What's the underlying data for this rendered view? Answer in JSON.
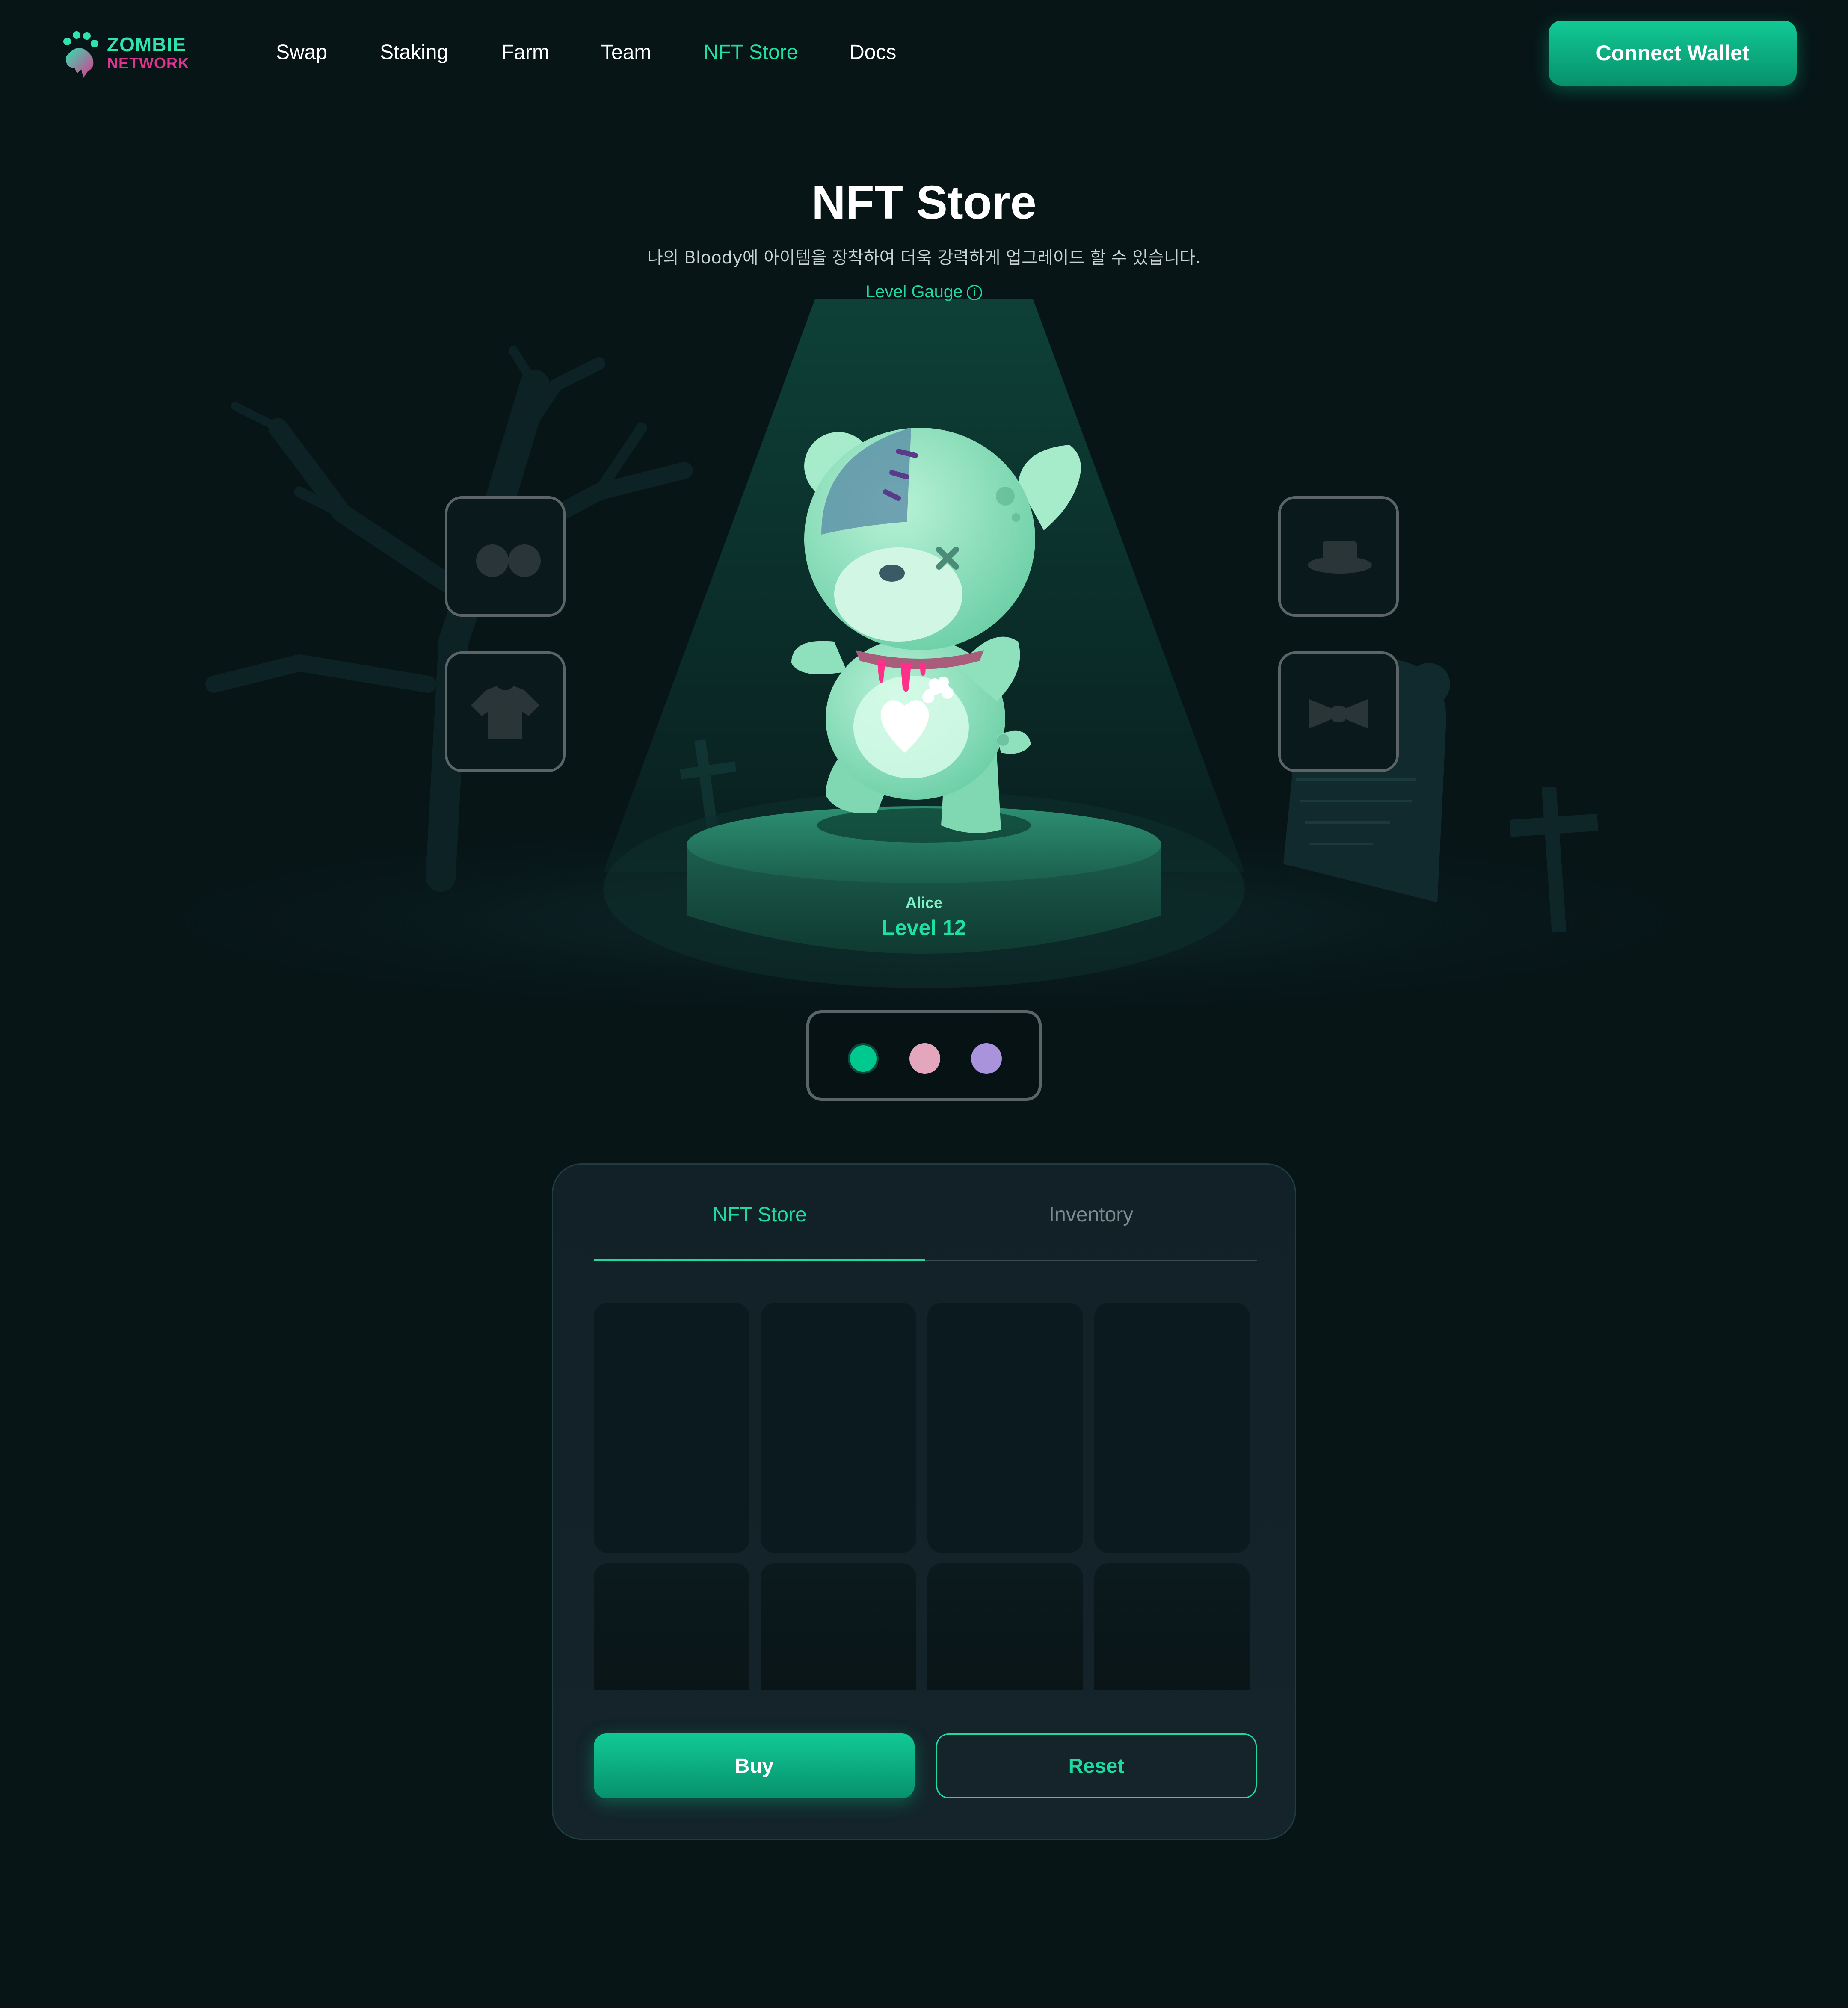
{
  "brand": {
    "line1": "ZOMBIE",
    "line2": "NETWORK"
  },
  "nav": {
    "links": [
      {
        "label": "Swap",
        "active": false
      },
      {
        "label": "Staking",
        "active": false
      },
      {
        "label": "Farm",
        "active": false
      },
      {
        "label": "Team",
        "active": false
      },
      {
        "label": "NFT Store",
        "active": true
      },
      {
        "label": "Docs",
        "active": false
      }
    ],
    "connect_label": "Connect Wallet"
  },
  "hero": {
    "title": "NFT Store",
    "subtitle": "나의 Bloody에 아이템을 장착하여 더욱 강력하게 업그레이드 할 수 있습니다.",
    "gauge_label": "Level Gauge",
    "gauge_icon": "info-icon"
  },
  "character": {
    "name": "Alice",
    "level": "Level 12"
  },
  "equipment_slots": {
    "left": [
      "glasses-icon",
      "shirt-icon"
    ],
    "right": [
      "hat-icon",
      "bowtie-icon"
    ]
  },
  "color_options": [
    {
      "color": "#00c990",
      "selected": true
    },
    {
      "color": "#e4a6bc",
      "selected": false
    },
    {
      "color": "#a893dc",
      "selected": false
    }
  ],
  "panel": {
    "tabs": [
      {
        "label": "NFT Store",
        "active": true
      },
      {
        "label": "Inventory",
        "active": false
      }
    ],
    "item_count": 8,
    "buy_label": "Buy",
    "reset_label": "Reset"
  },
  "colors": {
    "accent": "#1fd9a0",
    "background": "#071517",
    "brand_pink": "#e0338f"
  }
}
